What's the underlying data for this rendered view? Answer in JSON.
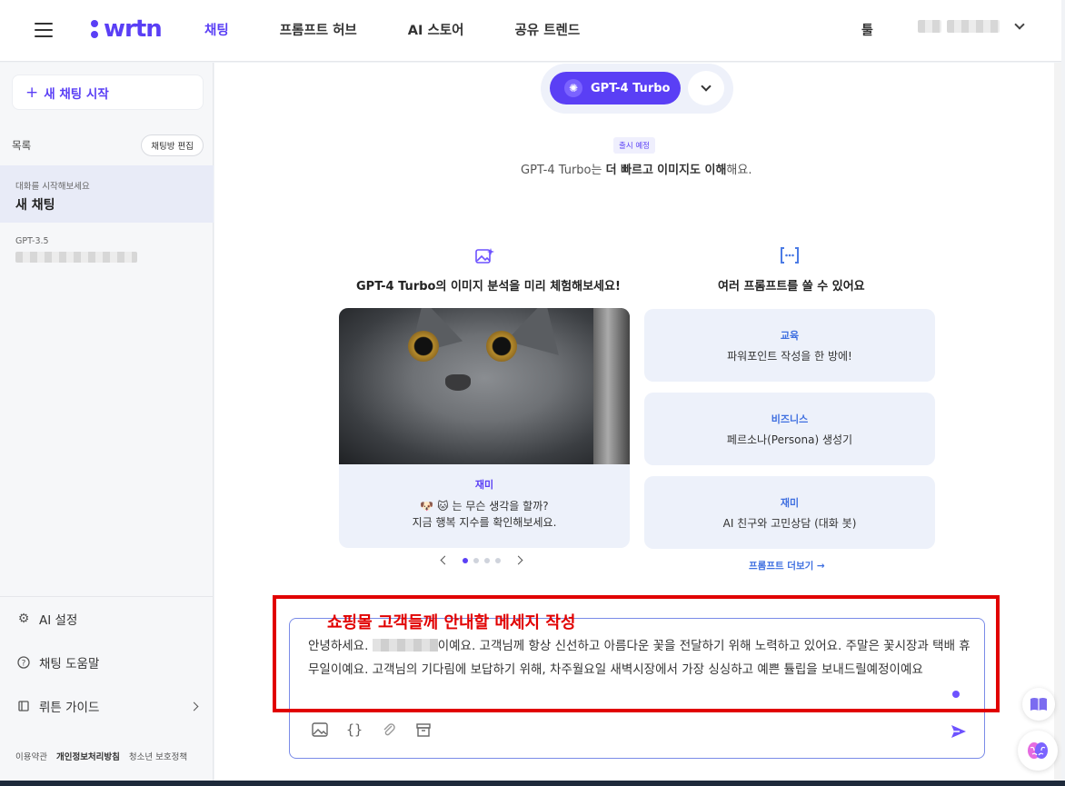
{
  "header": {
    "logo": "wrtn",
    "nav": [
      "채팅",
      "프롬프트 허브",
      "AI 스토어",
      "공유 트렌드"
    ],
    "active_nav": "채팅",
    "tool_label": "툴"
  },
  "sidebar": {
    "new_chat": "새 채팅 시작",
    "list_label": "목록",
    "edit_label": "채팅방 편집",
    "chats": [
      {
        "sub": "대화를 시작해보세요",
        "title": "새 채팅"
      },
      {
        "sub": "GPT-3.5",
        "title": ""
      }
    ],
    "links": [
      "AI 설정",
      "채팅 도움말",
      "뤼튼 가이드"
    ],
    "footer": [
      "이용약관",
      "개인정보처리방침",
      "청소년 보호정책"
    ]
  },
  "model": {
    "name": "GPT-4 Turbo",
    "badge": "출시 예정",
    "tagline_pre": "GPT-4 Turbo는 ",
    "tagline_bold1": "더 빠르고",
    "tagline_mid": " ",
    "tagline_bold2": "이미지도 이해",
    "tagline_post": "해요."
  },
  "sections": {
    "left_title": "GPT-4 Turbo의 이미지 분석을 미리 체험해보세요!",
    "right_title": "여러 프롬프트를 쓸 수 있어요"
  },
  "image_card": {
    "tag": "재미",
    "line1": "🐶 🐱 는 무슨 생각을 할까?",
    "line2": "지금 행복 지수를 확인해보세요."
  },
  "prompt_cards": [
    {
      "tag": "교육",
      "text": "파워포인트 작성을 한 방에!"
    },
    {
      "tag": "비즈니스",
      "text": "페르소나(Persona) 생성기"
    },
    {
      "tag": "재미",
      "text": "AI 친구와 고민상담 (대화 봇)"
    }
  ],
  "more_prompts": "프롬프트 더보기 →",
  "carousel": {
    "pages": 4,
    "current": 1
  },
  "input": {
    "text_pre": "안녕하세요. ",
    "text_post": "이예요. 고객님께 항상 신선하고 아름다운 꽃을 전달하기 위해 노력하고 있어요. 주말은 꽃시장과 택배 휴무일이예요. 고객님의 기다림에 보답하기 위해, 차주월요일 새벽시장에서 가장 싱싱하고 예쁜 튤립을 보내드릴예정이예요"
  },
  "annotation": {
    "text": "쇼핑몰 고객들께 안내할 메세지 작성",
    "color": "#e10000"
  },
  "colors": {
    "accent": "#5a3ff5",
    "link": "#3f6fe0"
  }
}
